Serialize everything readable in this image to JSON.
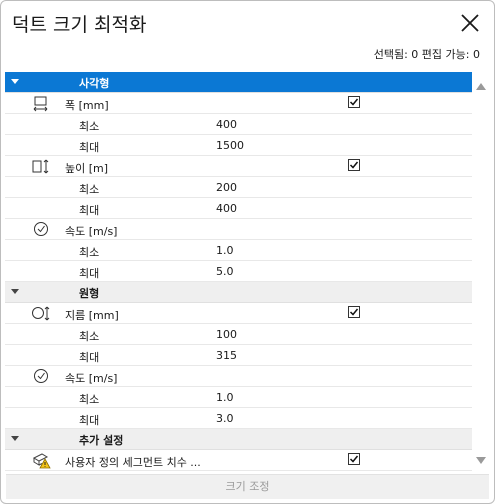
{
  "window": {
    "title": "덕트 크기 최적화"
  },
  "status": {
    "selection_text": "선택됨: 0 편집 가능: 0"
  },
  "groups": [
    {
      "label": "사각형",
      "selected": true
    },
    {
      "label": "원형",
      "selected": false
    },
    {
      "label": "추가 설정",
      "selected": false
    }
  ],
  "rect": {
    "width": {
      "label": "폭 [mm]",
      "checked": true,
      "min_label": "최소",
      "min": "400",
      "max_label": "최대",
      "max": "1500"
    },
    "height": {
      "label": "높이 [m]",
      "checked": true,
      "min_label": "최소",
      "min": "200",
      "max_label": "최대",
      "max": "400"
    },
    "velocity": {
      "label": "속도 [m/s]",
      "min_label": "최소",
      "min": "1.0",
      "max_label": "최대",
      "max": "5.0"
    }
  },
  "round": {
    "diameter": {
      "label": "지름 [mm]",
      "checked": true,
      "min_label": "최소",
      "min": "100",
      "max_label": "최대",
      "max": "315"
    },
    "velocity": {
      "label": "속도 [m/s]",
      "min_label": "최소",
      "min": "1.0",
      "max_label": "최대",
      "max": "3.0"
    }
  },
  "extra": {
    "custom_segment": {
      "label": "사용자 정의 세그먼트 치수 ...",
      "checked": true
    }
  },
  "footer": {
    "button_label": "크기 조정"
  },
  "colors": {
    "selected_row": "#0b78d4",
    "group_row": "#efefef",
    "warning": "#f5c518"
  },
  "icons": [
    "close-icon",
    "width-icon",
    "height-icon",
    "velocity-icon",
    "diameter-icon",
    "custom-segment-warning-icon",
    "checkmark-icon",
    "scroll-up-icon",
    "scroll-down-icon"
  ]
}
